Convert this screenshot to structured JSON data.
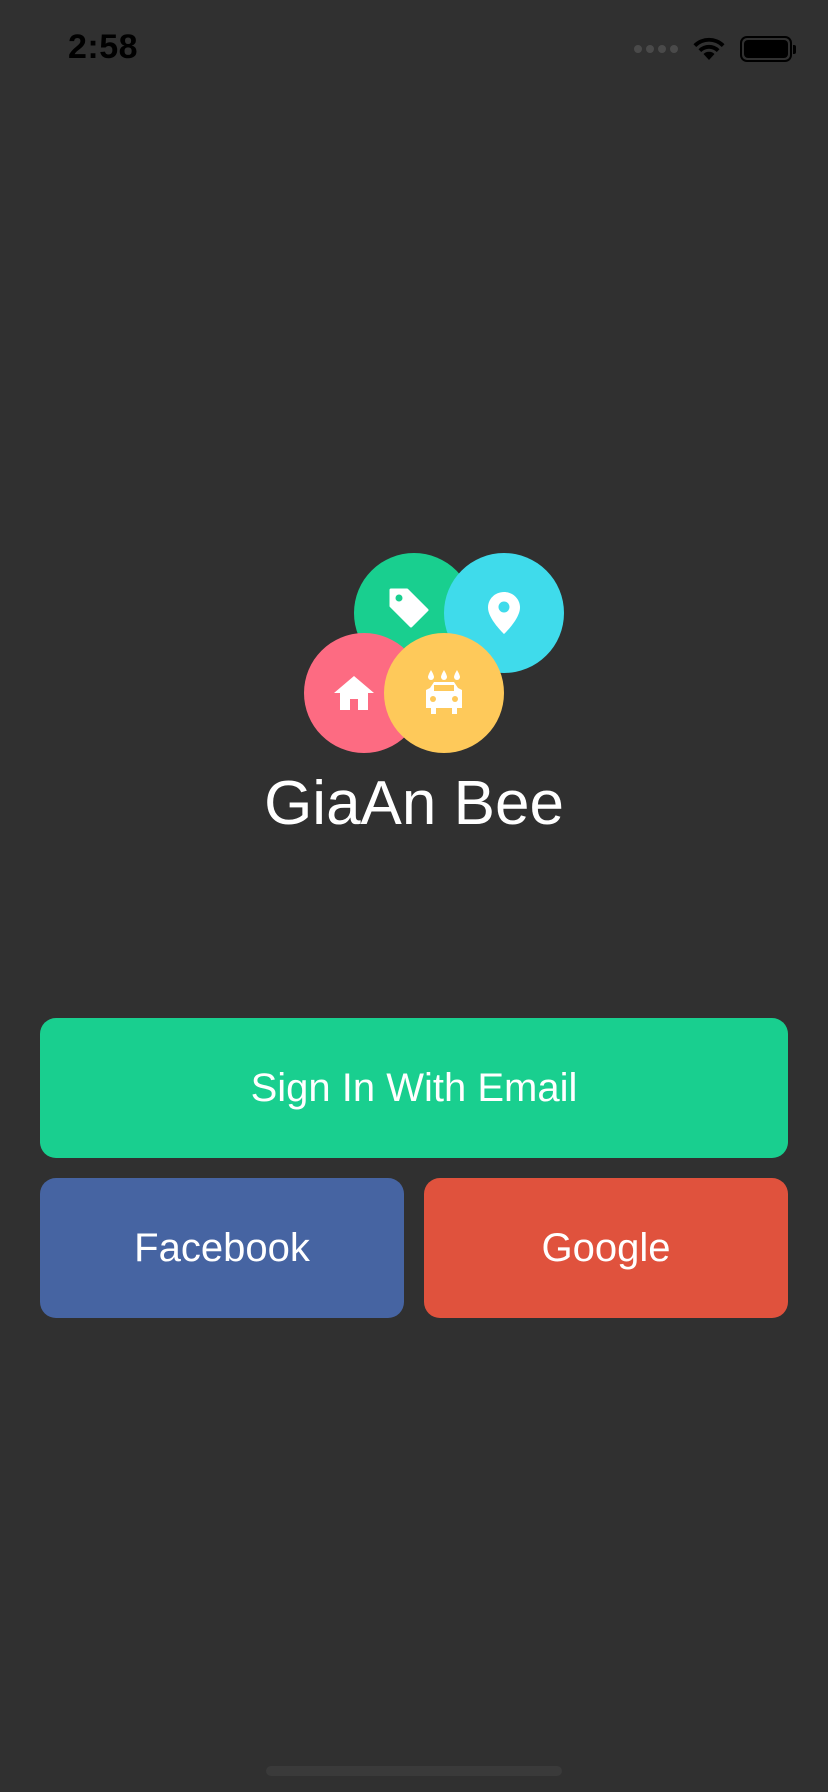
{
  "status_bar": {
    "time": "2:58",
    "icons": [
      "cellular-signal-icon",
      "wifi-icon",
      "battery-icon"
    ]
  },
  "app": {
    "name": "GiaAn Bee",
    "logo_icons": [
      {
        "name": "tag-icon",
        "color": "#19cf8f"
      },
      {
        "name": "location-pin-icon",
        "color": "#3fdbeb"
      },
      {
        "name": "home-icon",
        "color": "#fd6b82"
      },
      {
        "name": "car-wash-icon",
        "color": "#fec95a"
      }
    ]
  },
  "buttons": {
    "email_label": "Sign In With Email",
    "facebook_label": "Facebook",
    "google_label": "Google"
  },
  "colors": {
    "background": "#303030",
    "email": "#19cf8f",
    "facebook": "#4664a2",
    "google": "#e0523d"
  }
}
